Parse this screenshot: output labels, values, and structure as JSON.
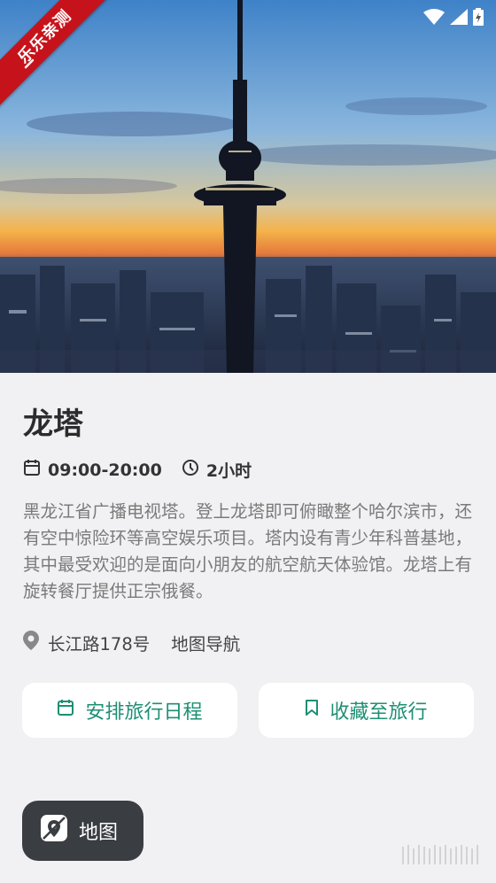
{
  "ribbon": {
    "label": "乐乐亲测"
  },
  "attraction": {
    "title": "龙塔",
    "hours": "09:00-20:00",
    "duration": "2小时",
    "description": "黑龙江省广播电视塔。登上龙塔即可俯瞰整个哈尔滨市，还有空中惊险环等高空娱乐项目。塔内设有青少年科普基地，其中最受欢迎的是面向小朋友的航空航天体验馆。龙塔上有旋转餐厅提供正宗俄餐。",
    "address": "长江路178号",
    "nav_label": "地图导航"
  },
  "actions": {
    "schedule_label": "安排旅行日程",
    "favorite_label": "收藏至旅行"
  },
  "map_button": {
    "label": "地图"
  },
  "colors": {
    "accent": "#1d8f73",
    "ribbon": "#c6131b",
    "map_button_bg": "#3a3d42"
  },
  "icons": {
    "calendar": "calendar-icon",
    "clock": "clock-icon",
    "pin": "location-pin-icon",
    "bookmark": "bookmark-icon",
    "map": "map-icon",
    "back": "back-arrow-icon",
    "wifi": "wifi-icon",
    "signal": "signal-icon",
    "battery": "battery-icon"
  }
}
